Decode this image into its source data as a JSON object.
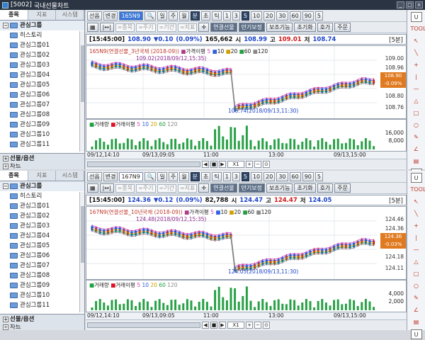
{
  "title_bar": {
    "code": "[5002]",
    "name": "국내선물차트"
  },
  "left": {
    "tabs": [
      "종목",
      "지표",
      "시스템"
    ],
    "root": "관심그룹",
    "items": [
      "히스토리",
      "관심그룹01",
      "관심그룹02",
      "관심그룹03",
      "관심그룹04",
      "관심그룹05",
      "관심그룹06",
      "관심그룹07",
      "관심그룹08",
      "관심그룹09",
      "관심그룹10",
      "관심그룹11"
    ],
    "footer": "선물/옵션",
    "footer2": "차트"
  },
  "toolbar": {
    "sel1": "선옵",
    "sel2": "변경",
    "periods": [
      "일",
      "주",
      "월",
      "분",
      "초",
      "틱"
    ],
    "nums": [
      "1",
      "3",
      "5",
      "10",
      "20",
      "30",
      "60",
      "90",
      "5"
    ],
    "active_period": "분",
    "active_num": "5"
  },
  "toolbar2": {
    "fields": [
      "=종목",
      "=주기",
      "=기간",
      "=지표"
    ],
    "btns": [
      "연결선물",
      "만기보정",
      "보조기능",
      "초기화",
      "호가",
      "주문"
    ]
  },
  "panes": [
    {
      "code": "165N9",
      "time": "[15:45:00]",
      "price": "108.90",
      "chg": "▼0.10",
      "pct": "(0.09%)",
      "vol": "165,662",
      "o_label": "시",
      "o": "108.99",
      "h_label": "고",
      "h": "109.01",
      "l_label": "저",
      "l": "108.74",
      "interval": "[5분]",
      "legend": "165N9(연결선물_3년국채 (2018-09))",
      "ma_label": "가격이평",
      "ma": [
        "5",
        "10",
        "20",
        "60",
        "120"
      ],
      "hi_ann": "109.02(2018/09/12,15:35)",
      "lo_ann": "108.74(2018/09/13,11:30)",
      "yticks": [
        "109.00",
        "108.96",
        "108.84",
        "108.80",
        "108.76"
      ],
      "cur_price": "108.90",
      "cur_chg": "-0.09%",
      "vol_label": "거래량",
      "vol_ma": "거래이평",
      "vol_ticks": [
        "16,000",
        "8,000"
      ],
      "xticks": [
        "09/12,14:10",
        "09/13,09:05",
        "11:00",
        "13:00",
        "09/13,15:00"
      ],
      "zoom": "X1"
    },
    {
      "code": "167N9",
      "time": "[15:45:00]",
      "price": "124.36",
      "chg": "▼0.12",
      "pct": "(0.09%)",
      "vol": "82,788",
      "o_label": "시",
      "o": "124.47",
      "h_label": "고",
      "h": "124.47",
      "l_label": "저",
      "l": "124.05",
      "interval": "[5분]",
      "legend": "167N9(연결선물_10년국채 (2018-09))",
      "ma_label": "가격이평",
      "ma": [
        "5",
        "10",
        "20",
        "60",
        "120"
      ],
      "hi_ann": "124.48(2018/09/12,15:35)",
      "lo_ann": "124.05(2018/09/13,11:30)",
      "yticks": [
        "124.46",
        "124.36",
        "124.25",
        "124.18",
        "124.11"
      ],
      "cur_price": "124.36",
      "cur_chg": "-0.03%",
      "vol_label": "거래량",
      "vol_ma": "거래이평",
      "vol_ticks": [
        "4,000",
        "2,000"
      ],
      "xticks": [
        "09/12,14:10",
        "09/13,09:05",
        "11:00",
        "13:00",
        "09/13,15:00"
      ],
      "zoom": "X1"
    }
  ],
  "right": [
    "U",
    "TOOL",
    "↖",
    "╲",
    "+",
    "|",
    "—",
    "△",
    "□",
    "○",
    "✎",
    "∠",
    "▤",
    "U"
  ]
}
